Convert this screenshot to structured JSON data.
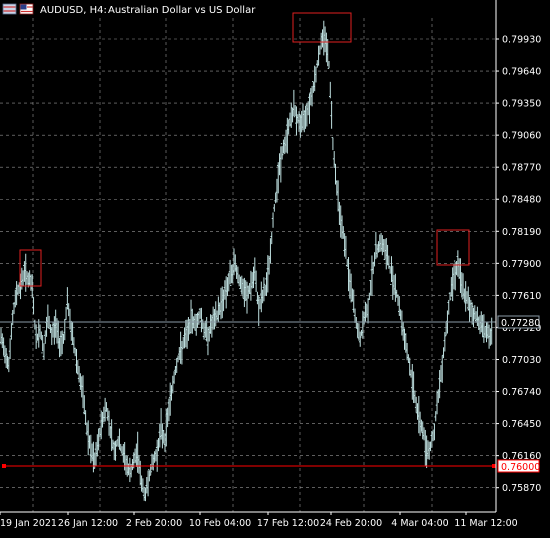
{
  "window": {
    "symbol": "AUDUSD, H4:",
    "description": "Australian Dollar vs US Dollar",
    "flag_icons": [
      "uk-flag-icon",
      "us-flag-icon"
    ]
  },
  "colors": {
    "background": "#000000",
    "grid": "#c8c8c8",
    "bars": "#bfe0e0",
    "axis_text": "#ffffff",
    "bid_line": "#8a9aa6",
    "level_line": "#ff0000",
    "highlight_box": "#e02020"
  },
  "chart_data": {
    "type": "line",
    "title": "AUDUSD, H4:  Australian Dollar vs US Dollar",
    "price_ticks": [
      "0.79930",
      "0.79640",
      "0.79350",
      "0.79060",
      "0.78770",
      "0.78480",
      "0.78190",
      "0.77900",
      "0.77610",
      "0.77320",
      "0.77030",
      "0.76740",
      "0.76450",
      "0.76160",
      "0.75870"
    ],
    "time_ticks": [
      "19 Jan 2021",
      "26 Jan 12:00",
      "2 Feb 20:00",
      "10 Feb 04:00",
      "17 Feb 12:00",
      "24 Feb 20:00",
      "4 Mar 04:00",
      "11 Mar 12:00"
    ],
    "ylim": [
      0.7565,
      0.8012
    ],
    "current_price": "0.77280",
    "support_level": "0.76000",
    "grid": true,
    "series": [
      {
        "values": [
          0.7722,
          0.771,
          0.77,
          0.774,
          0.7765,
          0.777,
          0.7783,
          0.7776,
          0.7768,
          0.772,
          0.773,
          0.7712,
          0.774,
          0.7725,
          0.7735,
          0.7718,
          0.7722,
          0.7755,
          0.773,
          0.771,
          0.769,
          0.767,
          0.764,
          0.762,
          0.761,
          0.763,
          0.765,
          0.766,
          0.764,
          0.762,
          0.763,
          0.762,
          0.761,
          0.76,
          0.761,
          0.762,
          0.759,
          0.758,
          0.76,
          0.761,
          0.762,
          0.764,
          0.763,
          0.766,
          0.768,
          0.77,
          0.771,
          0.772,
          0.773,
          0.774,
          0.7735,
          0.7745,
          0.773,
          0.7725,
          0.7735,
          0.774,
          0.775,
          0.776,
          0.777,
          0.778,
          0.779,
          0.7775,
          0.7765,
          0.776,
          0.777,
          0.778,
          0.775,
          0.776,
          0.777,
          0.78,
          0.784,
          0.787,
          0.789,
          0.79,
          0.792,
          0.793,
          0.792,
          0.7915,
          0.7925,
          0.7935,
          0.795,
          0.797,
          0.799,
          0.7997,
          0.797,
          0.79,
          0.786,
          0.783,
          0.781,
          0.778,
          0.776,
          0.7735,
          0.772,
          0.774,
          0.775,
          0.778,
          0.78,
          0.781,
          0.7805,
          0.7795,
          0.778,
          0.777,
          0.775,
          0.773,
          0.771,
          0.769,
          0.767,
          0.765,
          0.764,
          0.762,
          0.7625,
          0.764,
          0.767,
          0.77,
          0.773,
          0.776,
          0.778,
          0.779,
          0.777,
          0.776,
          0.775,
          0.7745,
          0.774,
          0.7735,
          0.773,
          0.7725
        ]
      }
    ]
  }
}
